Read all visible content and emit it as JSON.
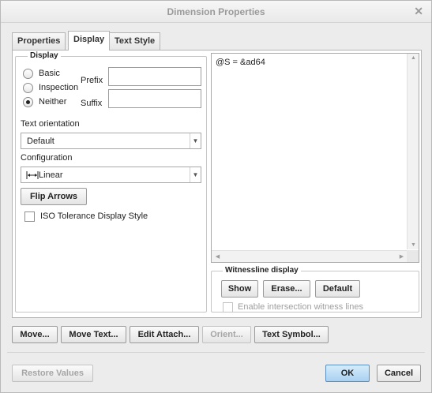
{
  "window": {
    "title": "Dimension Properties"
  },
  "tabs": [
    {
      "label": "Properties",
      "active": false
    },
    {
      "label": "Display",
      "active": true
    },
    {
      "label": "Text Style",
      "active": false
    }
  ],
  "display_group": {
    "label": "Display",
    "radios": [
      {
        "label": "Basic",
        "checked": false
      },
      {
        "label": "Inspection",
        "checked": false
      },
      {
        "label": "Neither",
        "checked": true
      }
    ],
    "prefix_label": "Prefix",
    "prefix_value": "",
    "suffix_label": "Suffix",
    "suffix_value": ""
  },
  "text_orientation": {
    "label": "Text orientation",
    "value": "Default"
  },
  "configuration": {
    "label": "Configuration",
    "value": "Linear",
    "icon": "linear-dimension-icon"
  },
  "flip_arrows_label": "Flip Arrows",
  "iso_tolerance": {
    "label": "ISO Tolerance Display Style",
    "checked": false
  },
  "dimension_text": "@S = &ad64",
  "witnessline_group": {
    "label": "Witnessline display",
    "buttons": {
      "show": "Show",
      "erase": "Erase...",
      "default": "Default"
    },
    "enable_intersection": {
      "label": "Enable intersection witness lines",
      "checked": false,
      "enabled": false
    }
  },
  "action_buttons": {
    "move": "Move...",
    "move_text": "Move Text...",
    "edit_attach": "Edit Attach...",
    "orient": "Orient...",
    "text_symbol": "Text Symbol..."
  },
  "footer": {
    "restore": "Restore Values",
    "ok": "OK",
    "cancel": "Cancel"
  }
}
